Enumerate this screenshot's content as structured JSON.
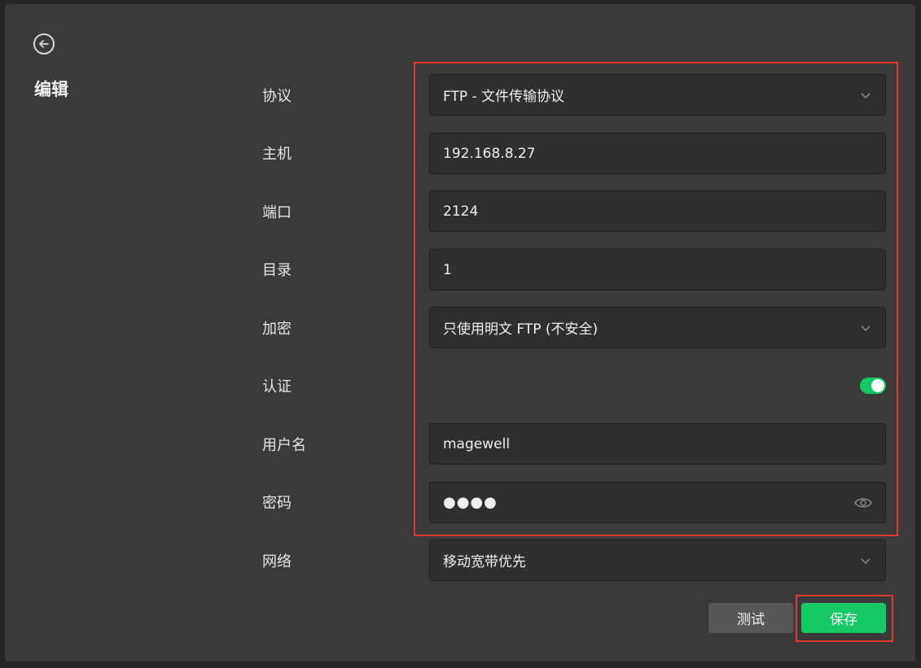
{
  "page": {
    "title": "编辑"
  },
  "form": {
    "protocol": {
      "label": "协议",
      "value": "FTP - 文件传输协议"
    },
    "host": {
      "label": "主机",
      "value": "192.168.8.27"
    },
    "port": {
      "label": "端口",
      "value": "2124"
    },
    "directory": {
      "label": "目录",
      "value": "1"
    },
    "encryption": {
      "label": "加密",
      "value": "只使用明文 FTP (不安全)"
    },
    "auth": {
      "label": "认证",
      "enabled": true
    },
    "username": {
      "label": "用户名",
      "value": "magewell"
    },
    "password": {
      "label": "密码",
      "value": "●●●●"
    },
    "network": {
      "label": "网络",
      "value": "移动宽带优先"
    }
  },
  "actions": {
    "test_label": "测试",
    "save_label": "保存"
  },
  "colors": {
    "accent": "#17c964",
    "highlight": "#e53935",
    "panel": "#3a3a3a",
    "field": "#2f2f2f"
  },
  "icons": {
    "back": "back-arrow-circle-icon",
    "dropdown": "chevron-down-icon",
    "reveal": "eye-icon"
  }
}
